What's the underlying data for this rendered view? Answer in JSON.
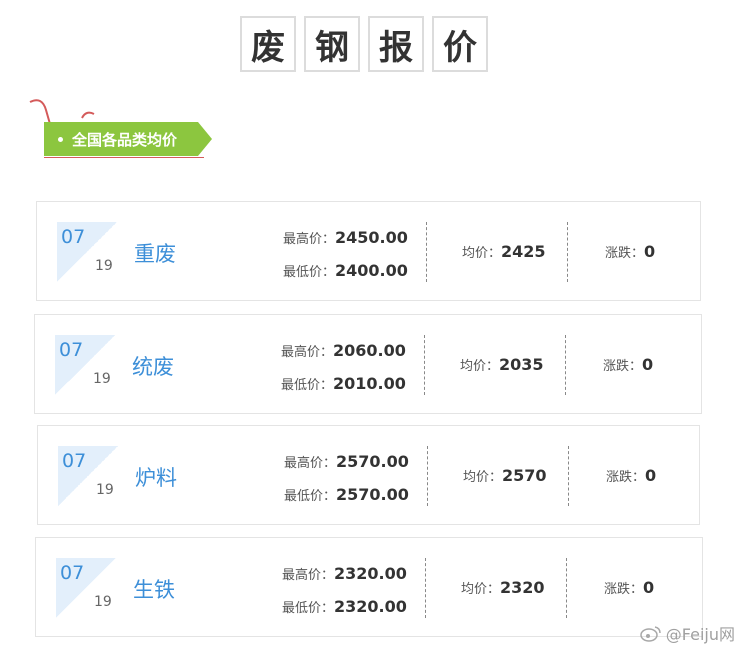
{
  "title": {
    "chars": [
      "废",
      "钢",
      "报",
      "价"
    ]
  },
  "section_tag": "全国各品类均价",
  "labels": {
    "high": "最高价：",
    "low": "最低价：",
    "avg": "均价：",
    "change": "涨跌："
  },
  "items": [
    {
      "month": "07",
      "day": "19",
      "name": "重废",
      "high": "2450.00",
      "low": "2400.00",
      "avg": "2425",
      "change": "0"
    },
    {
      "month": "07",
      "day": "19",
      "name": "统废",
      "high": "2060.00",
      "low": "2010.00",
      "avg": "2035",
      "change": "0"
    },
    {
      "month": "07",
      "day": "19",
      "name": "炉料",
      "high": "2570.00",
      "low": "2570.00",
      "avg": "2570",
      "change": "0"
    },
    {
      "month": "07",
      "day": "19",
      "name": "生铁",
      "high": "2320.00",
      "low": "2320.00",
      "avg": "2320",
      "change": "0"
    }
  ],
  "watermark": "@Feiju网",
  "colors": {
    "accent_blue": "#3d8fd8",
    "tag_green": "#8cc63f",
    "deco_red": "#d45a5a"
  },
  "icons": {
    "watermark_icon": "weibo-icon"
  }
}
